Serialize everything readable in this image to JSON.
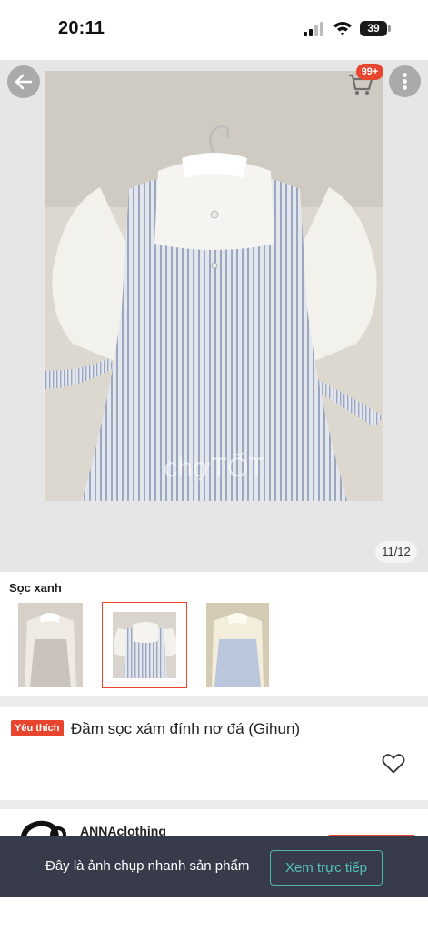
{
  "status_bar": {
    "time": "20:11",
    "battery": "39"
  },
  "gallery": {
    "cart_badge": "99+",
    "counter": "11/12",
    "watermark": "chợTỐT",
    "back_icon": "arrow-left-icon",
    "cart_icon": "shopping-cart-icon",
    "more_icon": "more-vertical-icon"
  },
  "variant": {
    "label": "Sọc xanh",
    "selected_index": 1
  },
  "product": {
    "tag": "Yêu thích",
    "title": "Đầm sọc xám đính nơ đá (Gihun)",
    "heart_icon": "heart-outline-icon"
  },
  "shop": {
    "name": "ANNAclothing"
  },
  "snapshot_banner": {
    "text": "Đây là ảnh chụp nhanh sản phẩm",
    "button": "Xem trực tiếp"
  },
  "colors": {
    "accent": "#e8452e",
    "teal": "#54c2bb",
    "banner_bg": "#383b4a"
  }
}
